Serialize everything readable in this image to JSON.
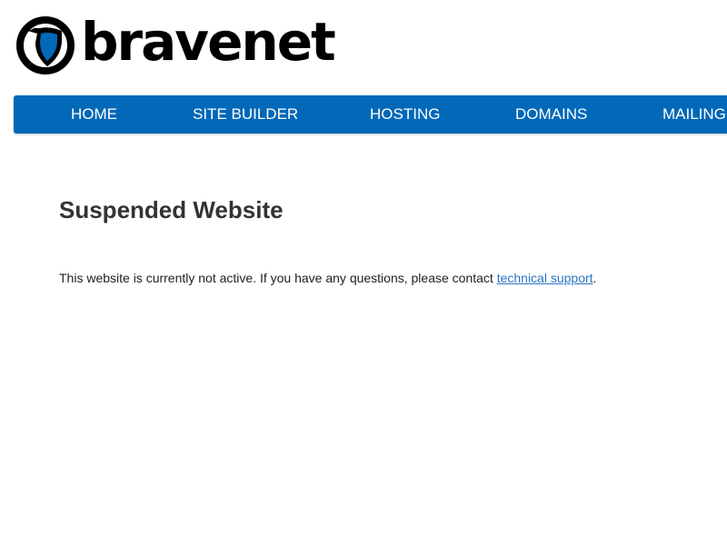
{
  "logo": {
    "wordmark": "bravenet",
    "icon": "bravenet-shield-logo-icon",
    "colors": {
      "ring": "#000000",
      "shield": "#0268b8"
    }
  },
  "nav": {
    "background": "#0268b8",
    "items": [
      {
        "label": "HOME"
      },
      {
        "label": "SITE BUILDER"
      },
      {
        "label": "HOSTING"
      },
      {
        "label": "DOMAINS"
      },
      {
        "label": "MAILING"
      }
    ]
  },
  "main": {
    "title": "Suspended Website",
    "message_before": "This website is currently not active. If you have any questions, please contact ",
    "link_text": "technical support",
    "message_after": ".",
    "link_color": "#2a74c4"
  }
}
